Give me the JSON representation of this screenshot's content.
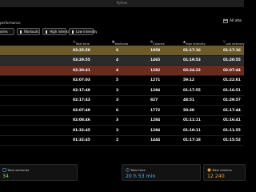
{
  "window": {
    "title": "Python"
  },
  "header": {
    "section_label": "performance",
    "period_button": "All atte"
  },
  "tabs": [
    {
      "label": "ories",
      "checked": false
    },
    {
      "label": "Workouts",
      "checked": false
    },
    {
      "label": "High intensity",
      "checked": false
    },
    {
      "label": "Low intensity",
      "checked": false
    }
  ],
  "table": {
    "columns": {
      "total_time": "Total time",
      "workouts": "Workouts",
      "calories": "Calories",
      "high": "High intensity",
      "low": "Low intensity"
    },
    "rows": [
      {
        "total_time": "03:25:50",
        "workouts": "6",
        "calories": "1958",
        "high": "01:17:16",
        "low": "01:17:16",
        "highlight": "#6b5a2a"
      },
      {
        "total_time": "03:29:55",
        "workouts": "4",
        "calories": "1465",
        "high": "01:19:53",
        "low": "01:20:55",
        "highlight": "#2b2b2b"
      },
      {
        "total_time": "02:30:41",
        "workouts": "4",
        "calories": "1282",
        "high": "03:34:22",
        "low": "02:07:44",
        "highlight": "#6a2a1e"
      },
      {
        "total_time": "02:07:03",
        "workouts": "5",
        "calories": "1271",
        "high": "59:12",
        "low": "01:22:01",
        "highlight": ""
      },
      {
        "total_time": "02:17:49",
        "workouts": "3",
        "calories": "1284",
        "high": "01:17:55",
        "low": "01:16:51",
        "highlight": ""
      },
      {
        "total_time": "02:17:43",
        "workouts": "3",
        "calories": "827",
        "high": "48:51",
        "low": "01:29:57",
        "highlight": ""
      },
      {
        "total_time": "02:07:49",
        "workouts": "6",
        "calories": "1772",
        "high": "50:30",
        "low": "01:17:44",
        "highlight": ""
      },
      {
        "total_time": "02:08:46",
        "workouts": "3",
        "calories": "1284",
        "high": "01:11:11",
        "low": "01:16:41",
        "highlight": ""
      },
      {
        "total_time": "01:32:45",
        "workouts": "3",
        "calories": "1284",
        "high": "01:10:11",
        "low": "01:11:55",
        "highlight": ""
      },
      {
        "total_time": "01:32:45",
        "workouts": "2",
        "calories": "1444",
        "high": "01:17:18",
        "low": "01:15:52",
        "highlight": ""
      }
    ]
  },
  "stats": {
    "workouts": {
      "label": "Total workouts",
      "value": "34",
      "color": "#7ed957"
    },
    "time": {
      "label": "Total time",
      "value": "20 h 53 min",
      "color": "#5ab4f0"
    },
    "calories": {
      "label": "Total calories",
      "value": "12 240",
      "color": "#f0a030"
    }
  }
}
